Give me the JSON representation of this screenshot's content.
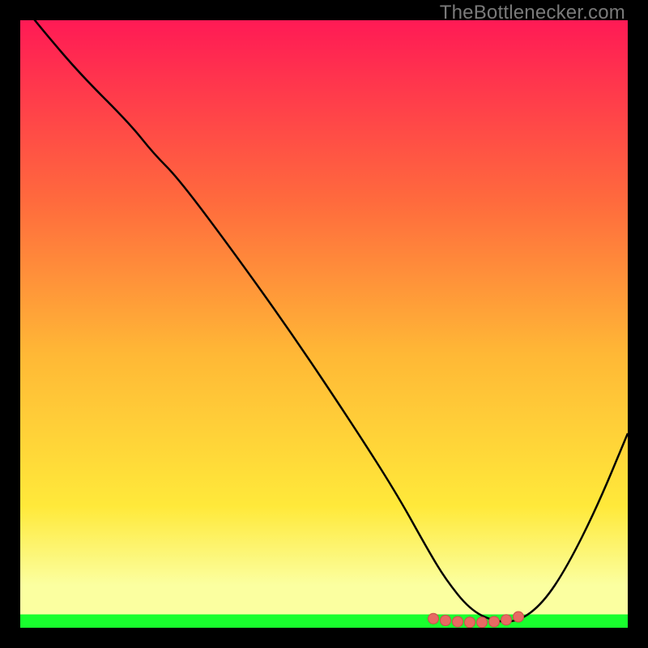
{
  "watermark": "TheBottlenecker.com",
  "colors": {
    "black": "#000000",
    "curve_stroke": "#000000",
    "marker_fill": "#e86a63",
    "marker_stroke": "#c94f49",
    "green_band": "#19ff2e",
    "grad_top": "#ff1a55",
    "grad_mid1": "#ff6b3d",
    "grad_mid2": "#ffb836",
    "grad_low": "#ffe93a",
    "grad_pale": "#fbffa0"
  },
  "chart_data": {
    "type": "line",
    "title": "",
    "xlabel": "",
    "ylabel": "",
    "xlim": [
      0,
      100
    ],
    "ylim": [
      0,
      100
    ],
    "series": [
      {
        "name": "bottleneck-curve",
        "x": [
          0,
          4,
          10,
          18,
          22,
          26,
          35,
          45,
          55,
          62,
          67,
          70,
          74,
          78,
          82,
          86,
          90,
          95,
          100
        ],
        "y": [
          103,
          98,
          91,
          83,
          78,
          74,
          62,
          48,
          33,
          22,
          13,
          8,
          3,
          1,
          1,
          4,
          10,
          20,
          32
        ]
      }
    ],
    "markers": {
      "name": "optimal-range",
      "x": [
        68,
        70,
        72,
        74,
        76,
        78,
        80,
        82
      ],
      "y": [
        1.5,
        1.2,
        1.0,
        0.9,
        0.9,
        1.0,
        1.3,
        1.8
      ]
    },
    "bands": [
      {
        "name": "green-optimal-band",
        "y_from": 0,
        "y_to": 2.2
      }
    ]
  }
}
